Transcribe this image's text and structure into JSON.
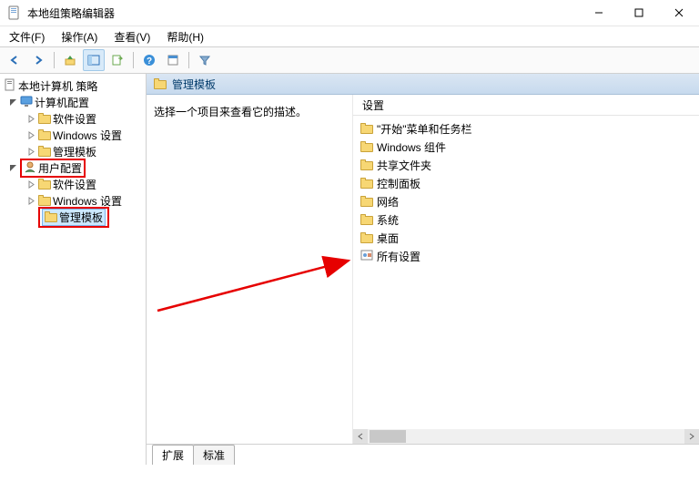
{
  "window": {
    "title": "本地组策略编辑器"
  },
  "menus": {
    "file": "文件(F)",
    "action": "操作(A)",
    "view": "查看(V)",
    "help": "帮助(H)"
  },
  "tree": {
    "root": "本地计算机 策略",
    "computer": "计算机配置",
    "c_soft": "软件设置",
    "c_win": "Windows 设置",
    "c_tmpl": "管理模板",
    "user": "用户配置",
    "u_soft": "软件设置",
    "u_win": "Windows 设置",
    "u_tmpl": "管理模板"
  },
  "path": {
    "label": "管理模板"
  },
  "desc": {
    "prompt": "选择一个项目来查看它的描述。"
  },
  "listhead": {
    "setting": "设置"
  },
  "items": {
    "start": "\"开始\"菜单和任务栏",
    "wincomp": "Windows 组件",
    "shared": "共享文件夹",
    "control": "控制面板",
    "network": "网络",
    "system": "系统",
    "desktop": "桌面",
    "all": "所有设置"
  },
  "tabs": {
    "extended": "扩展",
    "standard": "标准"
  }
}
